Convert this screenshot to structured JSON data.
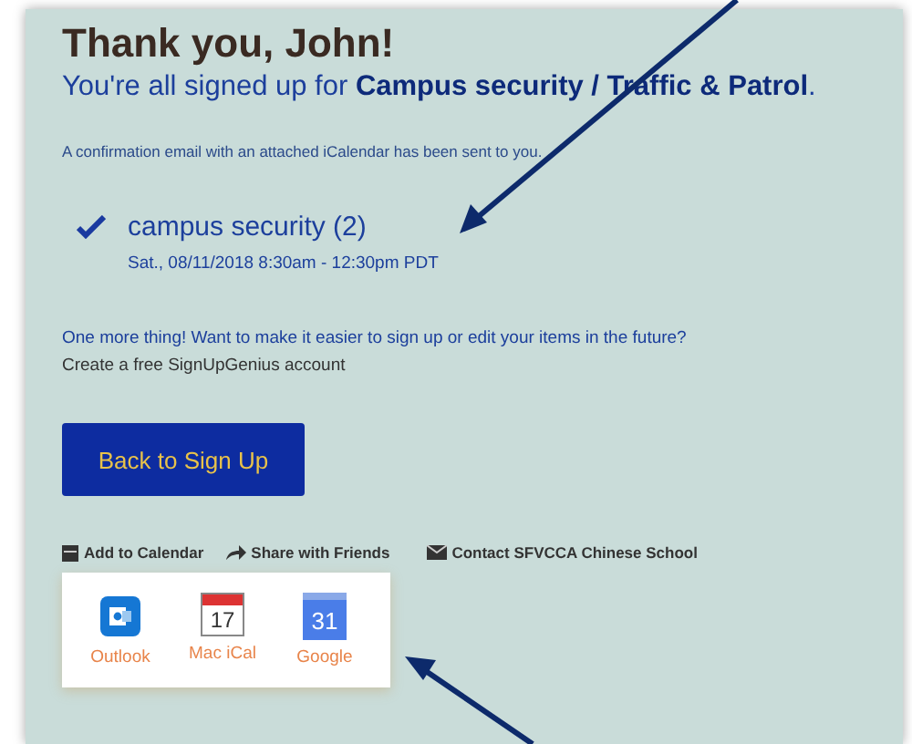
{
  "heading": "Thank you, John!",
  "subheading": "You're all signed up for **Campus security / Traffic & Patrol**.",
  "confirmation": "A confirmation email with an attached iCalendar has been sent to you.",
  "items": [
    {
      "title": "campus security (2)",
      "date": "Sat., 08/11/2018 8:30am - 12:30pm PDT",
      "checked": true
    }
  ],
  "promo": {
    "question": "One more thing! Want to make it easier to sign up or edit your items in the future?",
    "link": "Create a free SignUpGenius account"
  },
  "back_button": "Back to Sign Up",
  "actions": [
    {
      "kind": "calendar",
      "label": "Add to Calendar"
    },
    {
      "kind": "share",
      "label": "Share with Friends"
    },
    {
      "kind": "contact",
      "label": "Contact SFVCCA Chinese School"
    }
  ],
  "calendar_menu": [
    {
      "kind": "outlook",
      "label": "Outlook"
    },
    {
      "kind": "ical",
      "label": "Mac iCal",
      "icon_text": "17"
    },
    {
      "kind": "google",
      "label": "Google",
      "icon_text": "31"
    }
  ]
}
